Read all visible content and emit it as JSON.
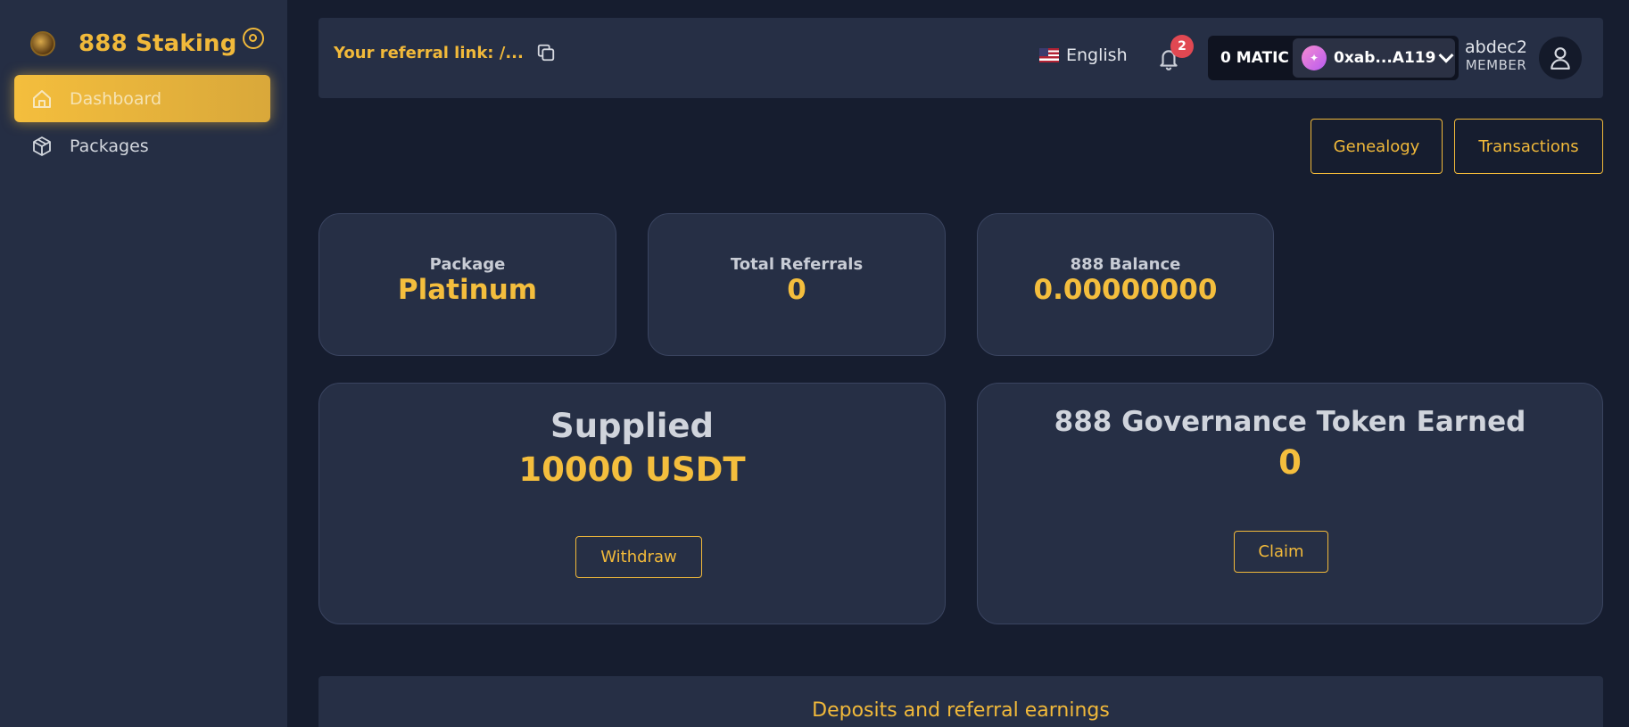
{
  "app": {
    "title": "888 Staking"
  },
  "sidebar": {
    "items": [
      {
        "label": "Dashboard",
        "icon": "home-icon",
        "active": true
      },
      {
        "label": "Packages",
        "icon": "package-icon",
        "active": false
      }
    ]
  },
  "topbar": {
    "referral_label": "Your referral link: /...",
    "language": "English",
    "notifications_count": "2",
    "balance": "0 MATIC",
    "account": "0xab...A119",
    "username": "abdec2",
    "role": "MEMBER"
  },
  "actions": {
    "genealogy": "Genealogy",
    "transactions": "Transactions"
  },
  "stats": [
    {
      "label": "Package",
      "value": "Platinum"
    },
    {
      "label": "Total Referrals",
      "value": "0"
    },
    {
      "label": "888 Balance",
      "value": "0.00000000"
    }
  ],
  "supplied": {
    "title": "Supplied",
    "value": "10000 USDT",
    "button": "Withdraw"
  },
  "governance": {
    "title": "888 Governance Token Earned",
    "value": "0",
    "button": "Claim"
  },
  "deposits": {
    "title": "Deposits and referral earnings"
  },
  "colors": {
    "accent": "#f1b93a",
    "background": "#161d2f",
    "panel": "#262f45",
    "sidebar": "#252e44",
    "badge": "#e14852"
  }
}
